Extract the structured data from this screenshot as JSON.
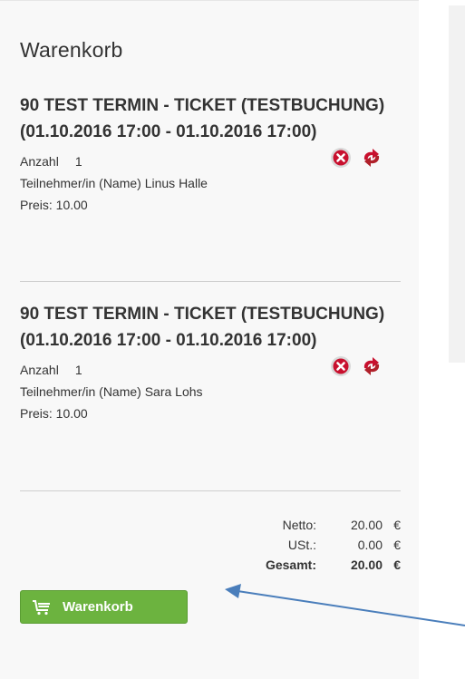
{
  "cart": {
    "title": "Warenkorb",
    "items": [
      {
        "title": "90 TEST TERMIN - TICKET (TESTBUCHUNG) (01.10.2016 17:00 - 01.10.2016 17:00)",
        "quantity_label": "Anzahl",
        "quantity": "1",
        "participant": "Teilnehmer/in (Name) Linus Halle",
        "price": "Preis: 10.00"
      },
      {
        "title": "90 TEST TERMIN - TICKET (TESTBUCHUNG) (01.10.2016 17:00 - 01.10.2016 17:00)",
        "quantity_label": "Anzahl",
        "quantity": "1",
        "participant": "Teilnehmer/in (Name) Sara Lohs",
        "price": "Preis: 10.00"
      }
    ],
    "totals": {
      "net_label": "Netto:",
      "net_value": "20.00",
      "tax_label": "USt.:",
      "tax_value": "0.00",
      "total_label": "Gesamt:",
      "total_value": "20.00",
      "currency": "€"
    },
    "button_label": "Warenkorb"
  },
  "colors": {
    "accent_green": "#6cb33f",
    "remove_red": "#c8102e",
    "annotation_arrow": "#4a7ebb"
  },
  "icons": {
    "remove": "close-circle-icon",
    "change": "swap-arrows-icon",
    "cart": "shopping-cart-icon"
  }
}
